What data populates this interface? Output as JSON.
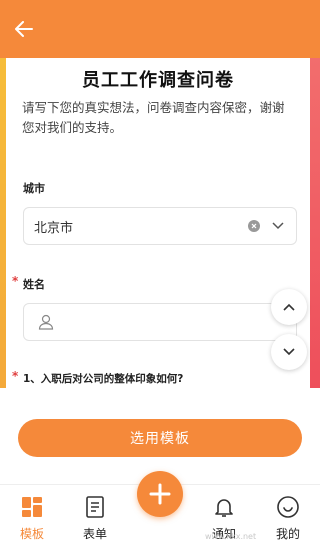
{
  "header": {
    "back_icon": "arrow-left-icon",
    "color": "#f5893a"
  },
  "survey": {
    "title": "员工工作调查问卷",
    "description": "请写下您的真实想法，问卷调查内容保密，谢谢您对我们的支持。",
    "city": {
      "label": "城市",
      "value": "北京市"
    },
    "name": {
      "label": "姓名",
      "required_mark": "*",
      "placeholder_icon": "user-icon"
    },
    "question1": {
      "text": "1、入职后对公司的整体印象如何?",
      "required_mark": "*"
    }
  },
  "actions": {
    "use_template": "选用模板"
  },
  "tabbar": {
    "tabs": [
      {
        "label": "模板",
        "icon": "template-icon",
        "active": true
      },
      {
        "label": "表单",
        "icon": "form-icon",
        "active": false
      },
      {
        "label": "通知",
        "icon": "bell-icon",
        "active": false
      },
      {
        "label": "我的",
        "icon": "profile-icon",
        "active": false
      }
    ],
    "fab_icon": "plus-icon"
  },
  "watermark": "www.kkx.net",
  "colors": {
    "accent": "#f5893a",
    "required": "#e04040"
  }
}
